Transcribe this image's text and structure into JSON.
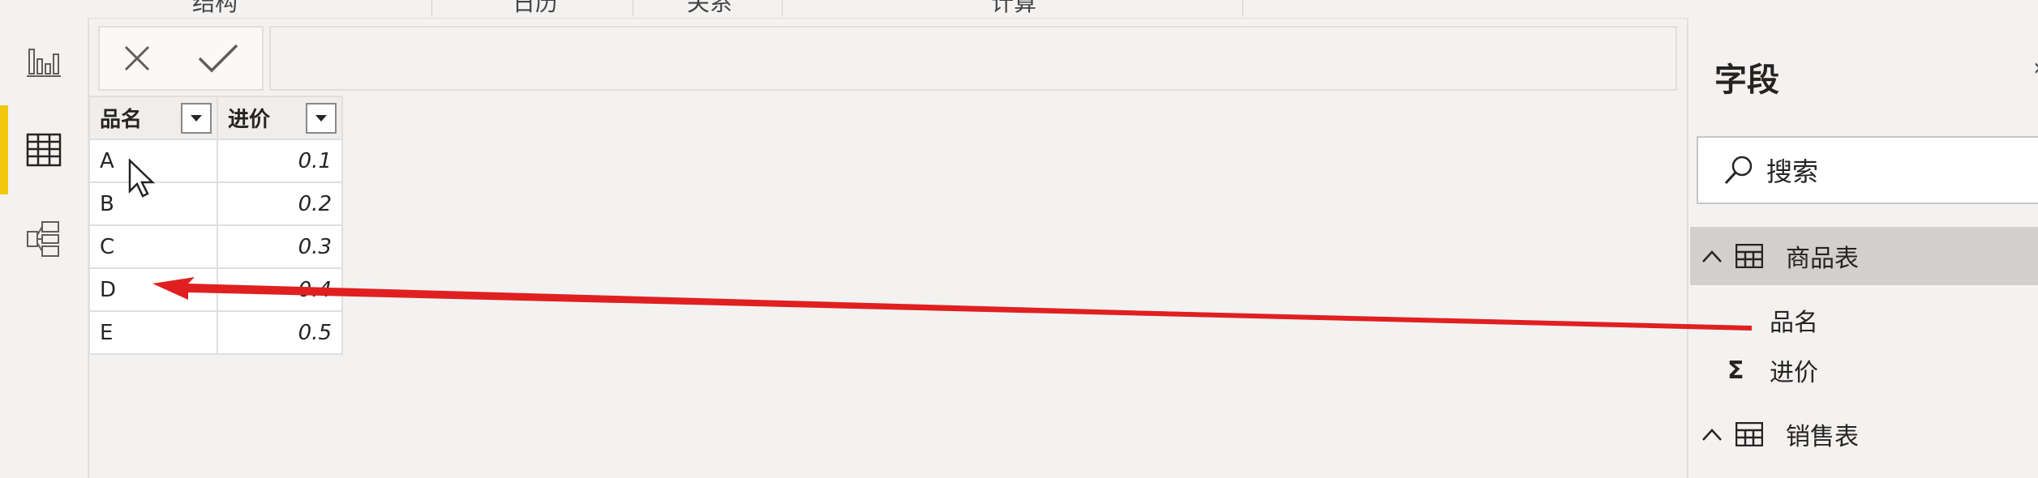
{
  "ribbon": {
    "groups": [
      "结构",
      "日历",
      "关系",
      "计算"
    ]
  },
  "formula_bar": {
    "cancel_icon": "close-icon",
    "commit_icon": "checkmark-icon",
    "value": ""
  },
  "table": {
    "columns": [
      "品名",
      "进价"
    ],
    "rows": [
      {
        "name": "A",
        "price": "0.1"
      },
      {
        "name": "B",
        "price": "0.2"
      },
      {
        "name": "C",
        "price": "0.3"
      },
      {
        "name": "D",
        "price": "0.4"
      },
      {
        "name": "E",
        "price": "0.5"
      }
    ]
  },
  "fields_pane": {
    "title": "字段",
    "search_placeholder": "搜索",
    "tables": [
      {
        "name": "商品表",
        "expanded": true,
        "fields": [
          {
            "name": "品名",
            "type": "text"
          },
          {
            "name": "进价",
            "type": "sum"
          }
        ]
      },
      {
        "name": "销售表",
        "expanded": true,
        "fields": []
      }
    ]
  },
  "colors": {
    "accent_active": "#f2c811",
    "annotation_arrow": "#e02020"
  }
}
